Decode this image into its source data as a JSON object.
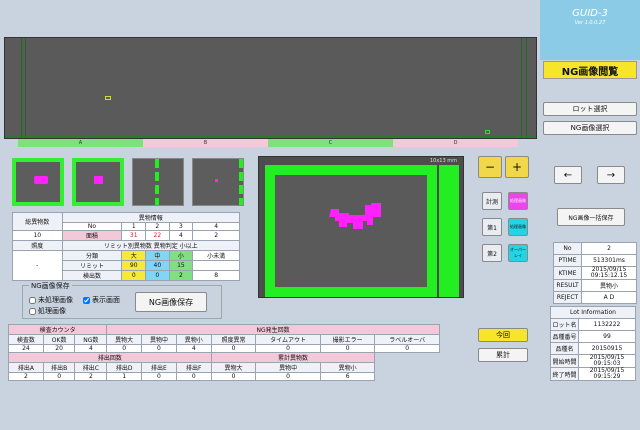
{
  "app": {
    "title": "GUID-3",
    "version": "Ver 1.0.0.27"
  },
  "screen_title": "NG画像閲覧",
  "lot_select": "ロット選択",
  "ng_image_select": "NG画像選択",
  "nav_prev": "←",
  "nav_next": "→",
  "bulk_save": "NG画像一括保存",
  "zones": [
    "A",
    "B",
    "C",
    "D"
  ],
  "big_view_label": "10x13 mm",
  "side_buttons": {
    "measure": "計測",
    "first": "第1",
    "second": "第2",
    "process": "処理画像",
    "sub_process": "処理画像",
    "overlay": "オーバーレイ"
  },
  "foreign_info": {
    "count_label": "総異物数",
    "count_value": "10",
    "header": "異物情報",
    "cols": [
      "No",
      "1",
      "2",
      "3",
      "4"
    ],
    "area_label": "面積",
    "area": [
      "31",
      "22",
      "4",
      "2"
    ],
    "brightness_label": "照度",
    "brightness_value": "-",
    "limit_header": "リミット別異物数 異物判定 小以上",
    "class_label": "分類",
    "classes": [
      "大",
      "中",
      "小",
      "小未満"
    ],
    "limit_label": "リミット",
    "limits": [
      "90",
      "40",
      "15",
      ""
    ],
    "detect_label": "検出数",
    "detects": [
      "0",
      "0",
      "2",
      "8"
    ]
  },
  "ng_save": {
    "title": "NG画像保存",
    "unprocessed": "未処理画像",
    "show_screen": "表示画面",
    "processed": "処理画像",
    "save_button": "NG画像保存"
  },
  "zoom_in": "+",
  "zoom_out": "−",
  "counters": {
    "inspect_header": "検査カウンタ",
    "ng_header": "NG発生回数",
    "inspect_cols": [
      "検査数",
      "OK数",
      "NG数"
    ],
    "inspect_vals": [
      "24",
      "20",
      "4"
    ],
    "ng_cols": [
      "異物大",
      "異物中",
      "異物小",
      "照度異常",
      "タイムアウト",
      "撮影エラー",
      "ラベルオーバ"
    ],
    "ng_vals": [
      "0",
      "0",
      "4",
      "0",
      "0",
      "0",
      "0"
    ],
    "detect_header": "排出回数",
    "detect_cols": [
      "排出A",
      "排出B",
      "排出C",
      "排出D",
      "排出E",
      "排出F"
    ],
    "detect_vals": [
      "2",
      "0",
      "2",
      "1",
      "0",
      "0"
    ],
    "total_header": "累計異物数",
    "total_cols": [
      "異物大",
      "異物中",
      "異物小"
    ],
    "total_vals": [
      "0",
      "0",
      "6"
    ]
  },
  "today": "今回",
  "cumulative": "累計",
  "info": {
    "no_label": "No",
    "no": "2",
    "ptime_label": "PTIME",
    "ptime": "513301ms",
    "ktime_label": "KTIME",
    "ktime": "2015/09/15 09:15:12.15",
    "result_label": "RESULT",
    "result": "異物小",
    "reject_label": "REJECT",
    "reject": "A  D"
  },
  "lot_info": {
    "header": "Lot Information",
    "lot_no_label": "ロット名",
    "lot_no": "1132222",
    "product_no_label": "品種番号",
    "product_no": "99",
    "product_name_label": "品種名",
    "product_name": "20150915",
    "start_label": "開始時間",
    "start": "2015/09/15 09:15:03",
    "end_label": "終了時間",
    "end": "2015/09/15 09:15:29"
  }
}
